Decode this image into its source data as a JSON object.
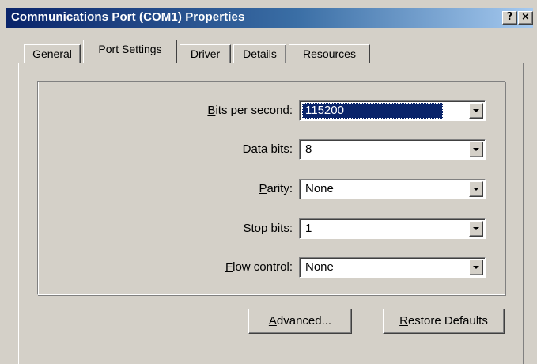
{
  "window": {
    "title": "Communications Port (COM1) Properties",
    "help_label": "?",
    "close_label": "×"
  },
  "tabs": [
    {
      "label": "General",
      "active": false
    },
    {
      "label": "Port Settings",
      "active": true
    },
    {
      "label": "Driver",
      "active": false
    },
    {
      "label": "Details",
      "active": false
    },
    {
      "label": "Resources",
      "active": false
    }
  ],
  "fields": {
    "bits_per_second": {
      "mnemonic": "B",
      "rest": "its per second:",
      "value": "115200"
    },
    "data_bits": {
      "mnemonic": "D",
      "rest": "ata bits:",
      "value": "8"
    },
    "parity": {
      "mnemonic": "P",
      "rest": "arity:",
      "value": "None"
    },
    "stop_bits": {
      "mnemonic": "S",
      "rest": "top bits:",
      "value": "1"
    },
    "flow_control": {
      "mnemonic": "F",
      "rest": "low control:",
      "value": "None"
    }
  },
  "buttons": {
    "advanced": {
      "mnemonic": "A",
      "rest": "dvanced..."
    },
    "restore": {
      "mnemonic": "R",
      "rest": "estore Defaults"
    }
  },
  "colors": {
    "face": "#d4d0c8",
    "title_start": "#0a246a",
    "title_end": "#a6caf0",
    "selection": "#0a246a"
  }
}
